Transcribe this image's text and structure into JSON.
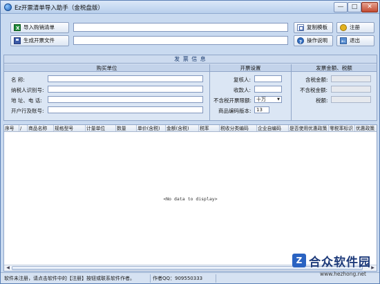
{
  "window": {
    "title": "Ez开票清单导入助手（金税盘版）",
    "min": "—",
    "max": "□",
    "close": "✕"
  },
  "toolbar": {
    "import_label": "导入购销清单",
    "generate_label": "生成开票文件",
    "copy_template_label": "复制模板",
    "help_label": "操作说明",
    "register_label": "注册",
    "exit_label": "退出",
    "import_path": "",
    "output_path": ""
  },
  "invoice_info": {
    "title": "发 票 信 息",
    "buyer": {
      "head": "购买单位",
      "name_label": "名          称:",
      "tax_id_label": "纳税人识别号:",
      "address_label": "地  址、电  话:",
      "bank_label": "开户行及账号:"
    },
    "settings": {
      "head": "开票设置",
      "reviewer_label": "复核人:",
      "payee_label": "收款人:",
      "limit_label": "不含税开票限额:",
      "limit_value": "十万",
      "version_label": "商品编码版本:",
      "version_value": "13"
    },
    "amounts": {
      "head": "发票金额、税额",
      "with_tax_label": "含税金额:",
      "without_tax_label": "不含税金额:",
      "tax_label": "税额:"
    }
  },
  "grid": {
    "columns": [
      "序号",
      "/",
      "商品名称",
      "规格型号",
      "计量单位",
      "数量",
      "单价(含税)",
      "金额(含税)",
      "税率",
      "税收分类编码",
      "企业自编码",
      "是否使用优惠政策",
      "零税率标识",
      "优惠政策"
    ],
    "empty_text": "<No data to display>"
  },
  "statusbar": {
    "message": "软件未注册，请点击软件中的【注册】按钮或联系软件作者。",
    "author_qq": "作者QQ：909550333"
  },
  "watermark": {
    "text": "合众软件园",
    "url": "www.hezhong.net"
  }
}
